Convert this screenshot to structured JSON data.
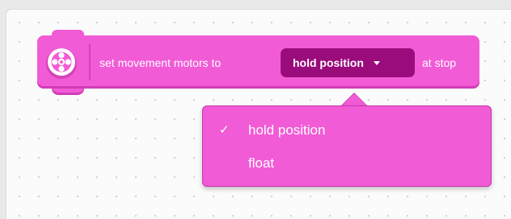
{
  "block": {
    "icon": "movement-motors-icon",
    "label_before": "set movement motors to",
    "dropdown_value": "hold position",
    "label_after": "at stop",
    "color": "#f25bd6",
    "dropdown_color": "#9a0b7c"
  },
  "menu": {
    "items": [
      {
        "check": "✓",
        "label": "hold position",
        "selected": true
      },
      {
        "check": "",
        "label": "float",
        "selected": false
      }
    ]
  }
}
